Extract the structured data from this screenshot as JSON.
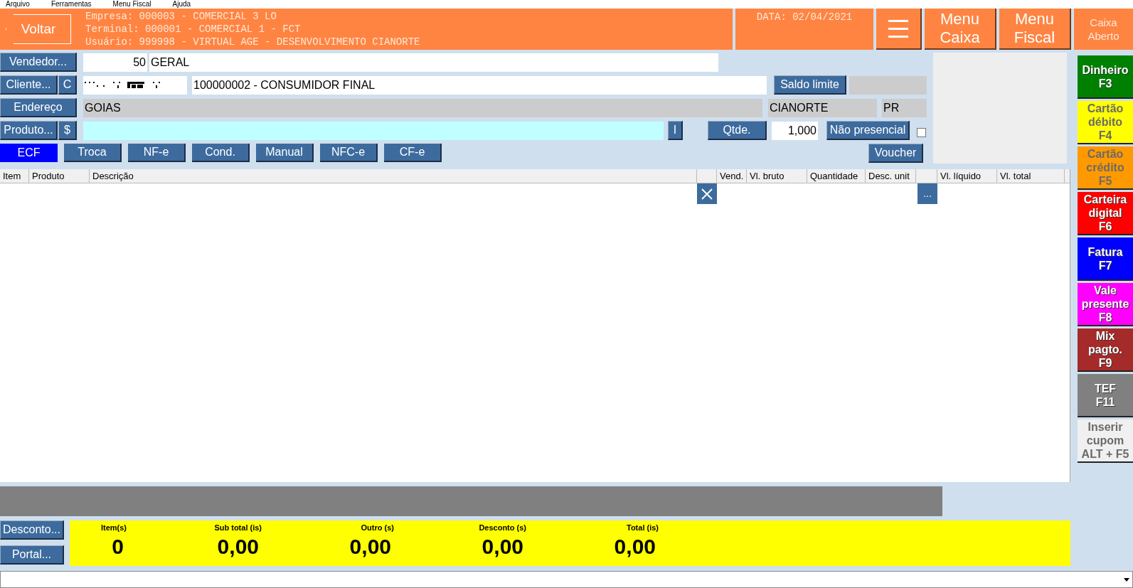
{
  "menu_bar": [
    "Arquivo",
    "Ferramentas",
    "Menu Fiscal",
    "Ajuda"
  ],
  "header": {
    "back_button": "Voltar",
    "info_lines": [
      "Empresa: 000003 - COMERCIAL 3 LO",
      "Terminal: 000001 - COMERCIAL 1 - FCT",
      "Usuário: 999998 - VIRTUAL AGE - DESENVOLVIMENTO CIANORTE"
    ],
    "date": "DATA: 02/04/2021",
    "menu_buttons": [
      {
        "line1": "Menu",
        "line2": "Caixa"
      },
      {
        "line1": "Menu",
        "line2": "Fiscal"
      }
    ],
    "status": {
      "line1": "Caixa",
      "line2": "Aberto"
    }
  },
  "form": {
    "vendedor": {
      "button": "Vendedor...",
      "code": "50",
      "name": "GERAL"
    },
    "cliente": {
      "button": "Cliente...",
      "c_button": "C",
      "name": "100000002 - CONSUMIDOR FINAL",
      "saldo_button": "Saldo limite"
    },
    "endereco": {
      "button": "Endereço",
      "address": "GOIAS",
      "city": "CIANORTE",
      "state": "PR"
    },
    "produto": {
      "button": "Produto...",
      "price_button": "$",
      "info_button": "I",
      "qtde_button": "Qtde.",
      "qtde": "1,000",
      "nao_presencial_button": "Não presencial",
      "nao_presencial_checked": false
    },
    "tabs": [
      {
        "label": "ECF",
        "selected": true
      },
      {
        "label": "Troca",
        "selected": false
      },
      {
        "label": "NF-e",
        "selected": false
      },
      {
        "label": "Cond.",
        "selected": false
      },
      {
        "label": "Manual",
        "selected": false
      },
      {
        "label": "NFC-e",
        "selected": false
      },
      {
        "label": "CF-e",
        "selected": false
      }
    ],
    "voucher_button": "Voucher"
  },
  "table": {
    "columns": [
      "Item",
      "Produto",
      "Descrição",
      "",
      "Vend.",
      "Vl. bruto",
      "Quantidade",
      "Desc. unit",
      "",
      "Vl. líquido",
      "Vl. total"
    ],
    "more_button": "..."
  },
  "side_buttons": [
    {
      "lines": [
        "Dinheiro",
        "F3"
      ],
      "color": "#008000"
    },
    {
      "lines": [
        "Cartão",
        "débito",
        "F4"
      ],
      "color": "#ffff00"
    },
    {
      "lines": [
        "Cartão",
        "crédito",
        "F5"
      ],
      "color": "#ff9900"
    },
    {
      "lines": [
        "Carteira",
        "digital",
        "F6"
      ],
      "color": "#ff0000"
    },
    {
      "lines": [
        "Fatura",
        "F7"
      ],
      "color": "#0000ff"
    },
    {
      "lines": [
        "Vale",
        "presente",
        "F8"
      ],
      "color": "#ff00ff"
    },
    {
      "lines": [
        "Mix",
        "pagto.",
        "F9"
      ],
      "color": "#a52a2a"
    },
    {
      "lines": [
        "TEF",
        "F11"
      ],
      "color": "#808080"
    },
    {
      "lines": [
        "Inserir",
        "cupom",
        "ALT + F5"
      ],
      "color": "#f0f0f0"
    }
  ],
  "bottom_buttons": [
    "Desconto...",
    "Portal..."
  ],
  "totals": [
    {
      "label": "Item(s)",
      "value": "0"
    },
    {
      "label": "Sub total (is)",
      "value": "0,00"
    },
    {
      "label": "Outro (s)",
      "value": "0,00"
    },
    {
      "label": "Desconto (s)",
      "value": "0,00"
    },
    {
      "label": "Total (is)",
      "value": "0,00"
    }
  ]
}
